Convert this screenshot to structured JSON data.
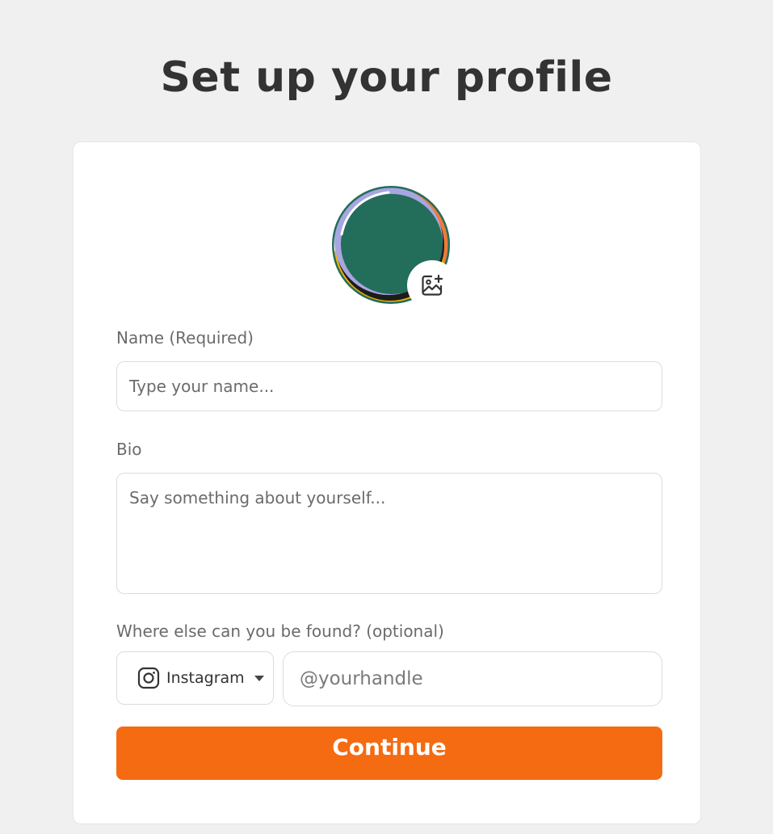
{
  "page": {
    "title": "Set up your profile"
  },
  "avatar": {
    "image_icon": "image-plus-icon"
  },
  "form": {
    "name": {
      "label": "Name (Required)",
      "placeholder": "Type your name...",
      "value": ""
    },
    "bio": {
      "label": "Bio",
      "placeholder": "Say something about yourself...",
      "value": ""
    },
    "social": {
      "label": "Where else can you be found? (optional)",
      "selected_platform": "Instagram",
      "platform_icon": "instagram-icon",
      "handle_placeholder": "@yourhandle",
      "handle_value": ""
    },
    "continue_label": "Continue"
  },
  "colors": {
    "accent": "#f46b12",
    "background": "#f0f0f0",
    "card": "#ffffff",
    "avatar_green": "#236d5b",
    "avatar_orange": "#f07a3a",
    "avatar_yellow": "#f5b400",
    "avatar_lavender": "#a8a6e0"
  }
}
